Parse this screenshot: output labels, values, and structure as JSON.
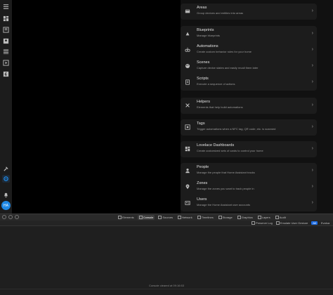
{
  "sidebar": {
    "icons": [
      "menu-icon",
      "dashboard-icon",
      "map-icon",
      "logbook-icon",
      "history-icon",
      "media-icon",
      "energy-icon"
    ],
    "bottom_icons": [
      "hammer-icon",
      "gear-icon",
      "bell-icon"
    ],
    "avatar_initials": "HA"
  },
  "settings": {
    "areas": {
      "title": "Areas",
      "subtitle": "Group devices and entities into areas"
    },
    "blueprints": {
      "title": "Blueprints",
      "subtitle": "Manage blueprints"
    },
    "automations": {
      "title": "Automations",
      "subtitle": "Create custom behavior rules for your home"
    },
    "scenes": {
      "title": "Scenes",
      "subtitle": "Capture device states and easily recall them later"
    },
    "scripts": {
      "title": "Scripts",
      "subtitle": "Execute a sequence of actions"
    },
    "helpers": {
      "title": "Helpers",
      "subtitle": "Elements that help build automations"
    },
    "tags": {
      "title": "Tags",
      "subtitle": "Trigger automations when a NFC tag, QR code, etc. is scanned"
    },
    "lovelace": {
      "title": "Lovelace Dashboards",
      "subtitle": "Create customized sets of cards to control your home"
    },
    "people": {
      "title": "People",
      "subtitle": "Manage the people that Home Assistant tracks"
    },
    "zones": {
      "title": "Zones",
      "subtitle": "Manage the zones you want to track people in"
    },
    "users": {
      "title": "Users",
      "subtitle": "Manage the Home Assistant user accounts"
    }
  },
  "devtools": {
    "tabs": [
      "Elements",
      "Console",
      "Sources",
      "Network",
      "Timelines",
      "Storage",
      "Graphics",
      "Layers",
      "Audit"
    ],
    "active_tab": "Console",
    "filters": {
      "preserve_log": "Preserve Log",
      "emulate": "Emulate User Gesture",
      "all": "All",
      "evaluate": "Evalua"
    },
    "console_message": "Console cleared at 09:16:53"
  },
  "colors": {
    "accent": "#1e88e5",
    "card": "#1c1c1c",
    "background": "#000000"
  }
}
